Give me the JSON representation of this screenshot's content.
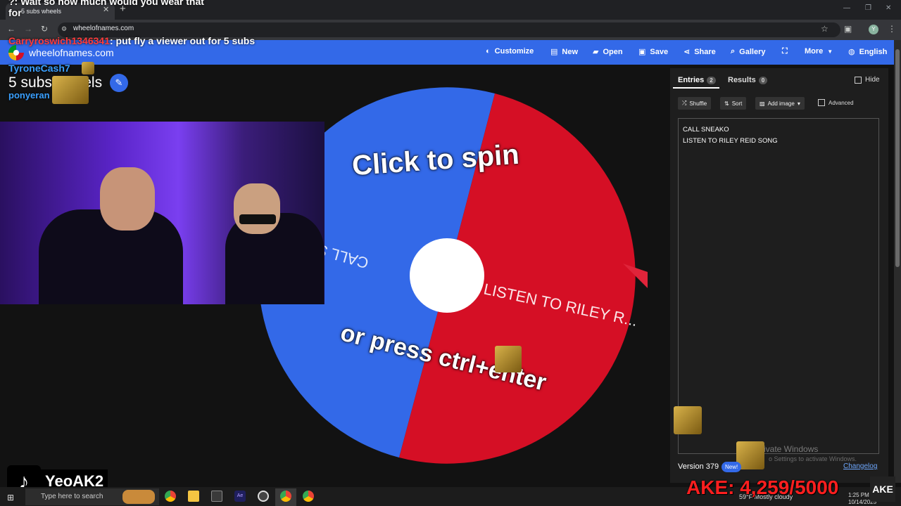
{
  "browser": {
    "tab_title": "5 subs wheels",
    "url": "wheelofnames.com"
  },
  "site": {
    "name": "wheelofnames.com",
    "nav": [
      {
        "label": "Customize",
        "icon": "palette-icon"
      },
      {
        "label": "New",
        "icon": "file-icon"
      },
      {
        "label": "Open",
        "icon": "folder-icon"
      },
      {
        "label": "Save",
        "icon": "save-icon"
      },
      {
        "label": "Share",
        "icon": "share-icon"
      },
      {
        "label": "Gallery",
        "icon": "search-icon"
      },
      {
        "label": "",
        "icon": "fullscreen-icon"
      },
      {
        "label": "More",
        "icon": "chevron-down-icon"
      },
      {
        "label": "English",
        "icon": "globe-icon"
      }
    ]
  },
  "wheel": {
    "title": "5 subs wheels",
    "spin_top": "Click to spin",
    "spin_bottom": "or press ctrl+enter",
    "segment_blue": "CALL S",
    "segment_red": "LISTEN TO RILEY R...",
    "colors": {
      "blue": "#3369e8",
      "red": "#d50f25"
    }
  },
  "panel": {
    "entries_tab": "Entries",
    "entries_count": "2",
    "results_tab": "Results",
    "results_count": "0",
    "hide_label": "Hide",
    "shuffle_label": "Shuffle",
    "sort_label": "Sort",
    "add_image_label": "Add image",
    "advanced_label": "Advanced",
    "entries": [
      "CALL SNEAKO",
      "LISTEN TO RILEY REID SONG"
    ],
    "version": "Version 379",
    "new_badge": "New!",
    "changelog": "Changelog",
    "activate_title": "ivate Windows",
    "activate_sub": "o Settings to activate Windows."
  },
  "chat": {
    "line1": "?: Wait so how much would you wear that",
    "line1b": "for",
    "line2_user": "Carryroswich1346341",
    "line2_msg": ": put fly a viewer out for 5 subs",
    "line3_user": "TyroneCash7",
    "line4_user": "ponyeran"
  },
  "overlay": {
    "tiktok_name": "YeoAK2",
    "subgoal": "AKE: 4,259/5000",
    "corner_logo": "AKE"
  },
  "taskbar": {
    "search_placeholder": "Type here to search",
    "weather": "59°F  Mostly cloudy",
    "time": "1:25 PM",
    "date": "10/14/2025"
  }
}
